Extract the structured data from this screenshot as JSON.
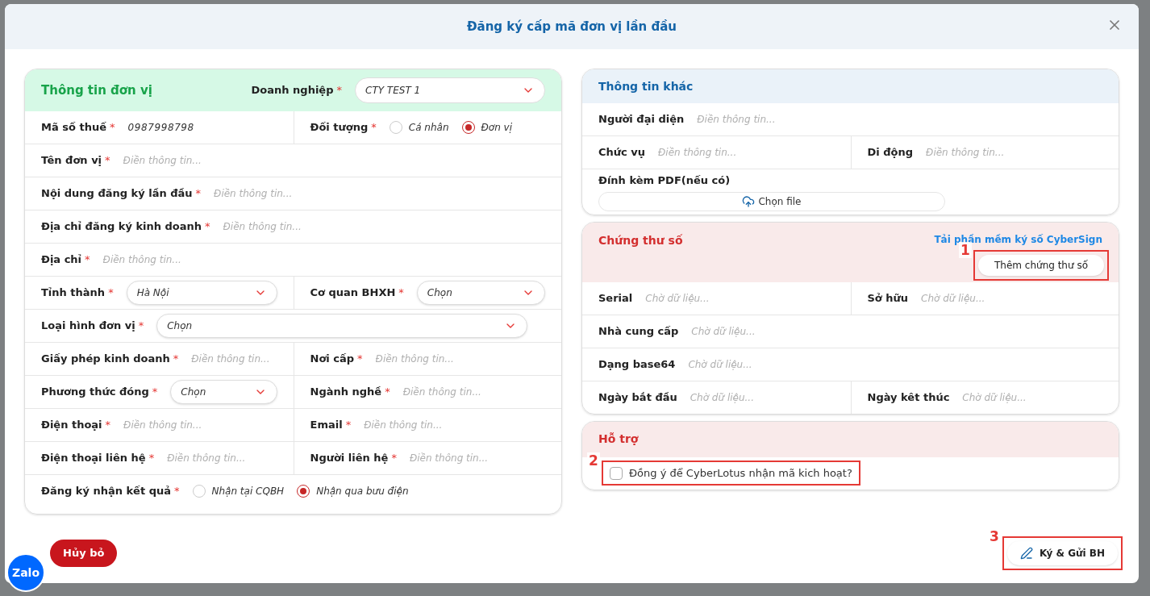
{
  "dialog": {
    "title": "Đăng ký cấp mã đơn vị lần đầu"
  },
  "unit_info": {
    "title": "Thông tin đơn vị",
    "company": {
      "label": "Doanh nghiệp",
      "mark": "*",
      "value": "CTY TEST 1"
    },
    "rows": [
      {
        "cells": [
          {
            "kind": "value",
            "label": "Mã số thuế",
            "mark": "*",
            "value": "0987998798"
          },
          {
            "kind": "radio",
            "label": "Đối tượng",
            "mark": "*",
            "options": [
              {
                "label": "Cá nhân",
                "selected": false
              },
              {
                "label": "Đơn vị",
                "selected": true
              }
            ]
          }
        ]
      },
      {
        "cells": [
          {
            "kind": "input",
            "label": "Tên đơn vị",
            "mark": "*",
            "placeholder": "Điền thông tin..."
          }
        ]
      },
      {
        "cells": [
          {
            "kind": "input",
            "label": "Nội dung đăng ký lần đầu",
            "mark": "*",
            "placeholder": "Điền thông tin..."
          }
        ]
      },
      {
        "cells": [
          {
            "kind": "input",
            "label": "Địa chỉ đăng ký kinh doanh",
            "mark": "*",
            "placeholder": "Điền thông tin..."
          }
        ]
      },
      {
        "cells": [
          {
            "kind": "input",
            "label": "Địa chỉ",
            "mark": "*",
            "placeholder": "Điền thông tin..."
          }
        ]
      },
      {
        "cells": [
          {
            "kind": "select",
            "label": "Tỉnh thành",
            "mark": "*",
            "value": "Hà Nội"
          },
          {
            "kind": "select",
            "label": "Cơ quan BHXH",
            "mark": "*",
            "value": "Chọn"
          }
        ]
      },
      {
        "cells": [
          {
            "kind": "select",
            "label": "Loại hình đơn vị",
            "mark": "*",
            "value": "Chọn"
          }
        ]
      },
      {
        "cells": [
          {
            "kind": "input",
            "label": "Giấy phép kinh doanh",
            "mark": "*",
            "placeholder": "Điền thông tin..."
          },
          {
            "kind": "input",
            "label": "Nơi cấp",
            "mark": "*",
            "placeholder": "Điền thông tin..."
          }
        ]
      },
      {
        "cells": [
          {
            "kind": "select",
            "label": "Phương thức đóng",
            "mark": "*",
            "value": "Chọn"
          },
          {
            "kind": "input",
            "label": "Ngành nghề",
            "mark": "*",
            "placeholder": "Điền thông tin..."
          }
        ]
      },
      {
        "cells": [
          {
            "kind": "input",
            "label": "Điện thoại",
            "mark": "*",
            "placeholder": "Điền thông tin..."
          },
          {
            "kind": "input",
            "label": "Email",
            "mark": "*",
            "placeholder": "Điền thông tin..."
          }
        ]
      },
      {
        "cells": [
          {
            "kind": "input",
            "label": "Điện thoại liên hệ",
            "mark": "*",
            "placeholder": "Điền thông tin..."
          },
          {
            "kind": "input",
            "label": "Người liên hệ",
            "mark": "*",
            "placeholder": "Điền thông tin..."
          }
        ]
      },
      {
        "cells": [
          {
            "kind": "radio",
            "label": "Đăng ký nhận kết quả",
            "mark": "*",
            "options": [
              {
                "label": "Nhận tại CQBH",
                "selected": false
              },
              {
                "label": "Nhận qua bưu điện",
                "selected": true
              }
            ]
          }
        ]
      }
    ]
  },
  "other_info": {
    "title": "Thông tin khác",
    "rows": [
      {
        "cells": [
          {
            "kind": "input",
            "label": "Người đại diện",
            "placeholder": "Điền thông tin..."
          }
        ]
      },
      {
        "cells": [
          {
            "kind": "input",
            "label": "Chức vụ",
            "placeholder": "Điền thông tin..."
          },
          {
            "kind": "input",
            "label": "Di động",
            "placeholder": "Điền thông tin..."
          }
        ]
      },
      {
        "cells": [
          {
            "kind": "file",
            "label": "Đính kèm PDF(nếu có)",
            "button": "Chọn file"
          }
        ]
      }
    ]
  },
  "certificate": {
    "title": "Chứng thư số",
    "link": "Tải phần mềm ký số CyberSign",
    "add_button": "Thêm chứng thư số",
    "marker": "1",
    "rows": [
      {
        "cells": [
          {
            "kind": "input",
            "label": "Serial",
            "placeholder": "Chờ dữ liệu..."
          },
          {
            "kind": "input",
            "label": "Sở hữu",
            "placeholder": "Chờ dữ liệu..."
          }
        ]
      },
      {
        "cells": [
          {
            "kind": "input",
            "label": "Nhà cung cấp",
            "placeholder": "Chờ dữ liệu..."
          }
        ]
      },
      {
        "cells": [
          {
            "kind": "input",
            "label": "Dạng base64",
            "placeholder": "Chờ dữ liệu..."
          }
        ]
      },
      {
        "cells": [
          {
            "kind": "input",
            "label": "Ngày bắt đầu",
            "placeholder": "Chờ dữ liệu..."
          },
          {
            "kind": "input",
            "label": "Ngày kêt thúc",
            "placeholder": "Chờ dữ liệu..."
          }
        ]
      }
    ]
  },
  "support": {
    "title": "Hỗ trợ",
    "checkbox": {
      "label": "Đồng ý để CyberLotus nhận mã kich hoạt?",
      "checked": false
    },
    "marker": "2"
  },
  "footer": {
    "cancel": "Hủy bỏ",
    "submit": "Ký & Gửi BH",
    "marker": "3"
  },
  "chat_bubble": "Zalo"
}
